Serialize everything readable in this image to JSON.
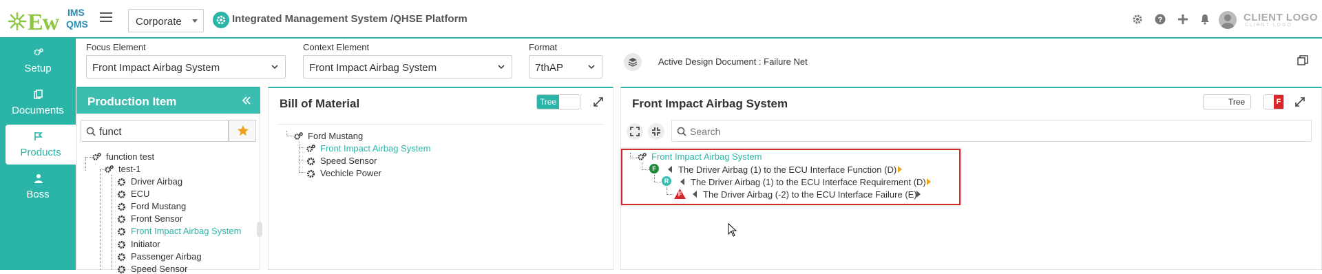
{
  "header": {
    "logo_ew": "Ew",
    "logo_ims": "IMS",
    "logo_qms": "QMS",
    "org_select": "Corporate",
    "app_title": "Integrated Management System /QHSE Platform",
    "client_logo": "CLIENT LOGO",
    "client_logo_sub": "CLIENT LOGO"
  },
  "nav": {
    "items": [
      {
        "label": "Setup",
        "icon": "gears-icon"
      },
      {
        "label": "Documents",
        "icon": "copy-icon"
      },
      {
        "label": "Products",
        "icon": "flag-icon",
        "active": true
      },
      {
        "label": "Boss",
        "icon": "user-icon"
      }
    ]
  },
  "filters": {
    "focus_label": "Focus Element",
    "focus_value": "Front Impact Airbag System",
    "context_label": "Context Element",
    "context_value": "Front Impact Airbag System",
    "format_label": "Format",
    "format_value": "7thAP",
    "active_doc": "Active Design Document : Failure Net"
  },
  "production": {
    "title": "Production Item",
    "search_value": "funct",
    "tree": [
      {
        "label": "function test",
        "level": 0
      },
      {
        "label": "test-1",
        "level": 1
      },
      {
        "label": "Driver Airbag",
        "level": 2
      },
      {
        "label": "ECU",
        "level": 2
      },
      {
        "label": "Ford Mustang",
        "level": 2
      },
      {
        "label": "Front Sensor",
        "level": 2
      },
      {
        "label": "Front Impact Airbag System",
        "level": 2,
        "selected": true
      },
      {
        "label": "Initiator",
        "level": 2
      },
      {
        "label": "Passenger Airbag",
        "level": 2
      },
      {
        "label": "Speed Sensor",
        "level": 2
      }
    ]
  },
  "bom": {
    "title": "Bill of Material",
    "toggle_label": "Tree",
    "tree": [
      {
        "label": "Ford Mustang",
        "level": 0
      },
      {
        "label": "Front Impact Airbag System",
        "level": 1,
        "selected": true
      },
      {
        "label": "Speed Sensor",
        "level": 1
      },
      {
        "label": "Vechicle Power",
        "level": 1
      }
    ]
  },
  "fia": {
    "title": "Front Impact Airbag System",
    "toggle_label": "Tree",
    "mode_badge": "F",
    "search_placeholder": "Search",
    "tree": {
      "root": "Front Impact Airbag System",
      "function": {
        "badge": "F",
        "text": "The Driver Airbag (1) to the ECU Interface Function (D)"
      },
      "requirement": {
        "badge": "R",
        "text": "The Driver Airbag (1) to the ECU Interface Requirement (D)"
      },
      "failure": {
        "badge": "F",
        "text": "The Driver Airbag (-2) to the ECU Interface Failure (E)"
      }
    }
  },
  "colors": {
    "accent": "#2bb5a8",
    "function_badge": "#1e8a3a",
    "requirement_badge": "#3dbdb0",
    "failure_badge": "#d9262b",
    "highlight_box": "#d9262b"
  }
}
